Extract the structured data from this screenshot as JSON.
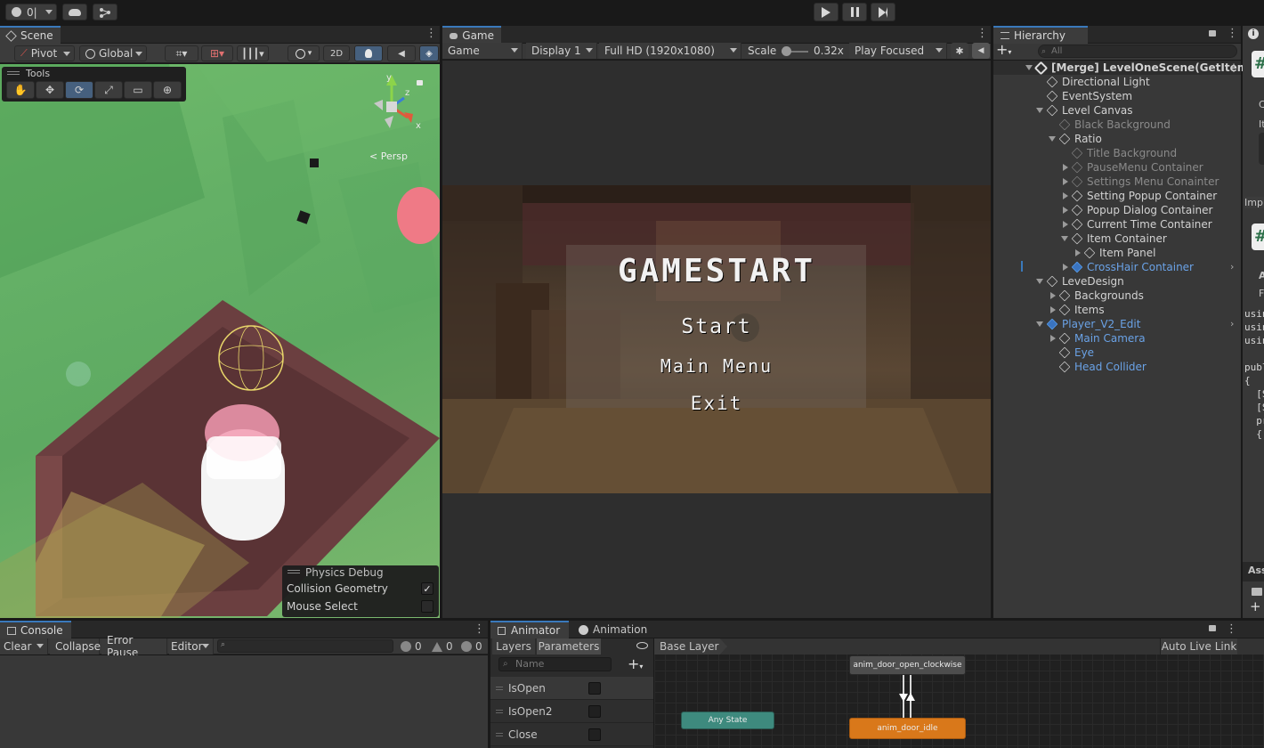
{
  "top": {
    "account_label": "0|"
  },
  "scene": {
    "tab": "Scene",
    "pivot": "Pivot",
    "global": "Global",
    "btn_2d": "2D",
    "tools_title": "Tools",
    "persp": "< Persp",
    "gizmo_y": "y",
    "gizmo_z": "z",
    "gizmo_x": "x",
    "physics_debug": {
      "title": "Physics Debug",
      "collision_geometry": "Collision Geometry",
      "collision_checked": true,
      "mouse_select": "Mouse Select",
      "mouse_checked": false
    }
  },
  "game": {
    "tab": "Game",
    "view": "Game",
    "display": "Display 1",
    "resolution": "Full HD (1920x1080)",
    "scale_label": "Scale",
    "scale_value": "0.32x",
    "play_mode": "Play Focused",
    "menu": {
      "title": "GAMESTART",
      "start": "Start",
      "main_menu": "Main Menu",
      "exit": "Exit"
    }
  },
  "hierarchy": {
    "tab": "Hierarchy",
    "search_placeholder": "All",
    "scene_name": "[Merge] LevelOneScene(GetItem",
    "items": [
      {
        "label": "Directional Light"
      },
      {
        "label": "EventSystem"
      },
      {
        "label": "Level Canvas"
      },
      {
        "label": "Black Background"
      },
      {
        "label": "Ratio"
      },
      {
        "label": "Title Background"
      },
      {
        "label": "PauseMenu Container"
      },
      {
        "label": "Settings Menu Conainter"
      },
      {
        "label": "Setting Popup Container"
      },
      {
        "label": "Popup Dialog Container"
      },
      {
        "label": "Current Time Container"
      },
      {
        "label": "Item Container"
      },
      {
        "label": "Item Panel"
      },
      {
        "label": "CrossHair Container"
      },
      {
        "label": "LeveDesign"
      },
      {
        "label": "Backgrounds"
      },
      {
        "label": "Items"
      },
      {
        "label": "Player_V2_Edit"
      },
      {
        "label": "Main Camera"
      },
      {
        "label": "Eye"
      },
      {
        "label": "Head Collider"
      }
    ]
  },
  "inspector": {
    "partial_labels": [
      "C",
      "It",
      "Imp",
      "A",
      "F",
      "Ass"
    ],
    "code_lines": [
      "usin",
      "usin",
      "usin",
      "",
      "publ",
      "{",
      "  [S",
      "  [S",
      "  pr",
      "  {"
    ],
    "hash1": "#",
    "hash2": "#"
  },
  "console": {
    "tab": "Console",
    "clear": "Clear",
    "collapse": "Collapse",
    "error_pause": "Error Pause",
    "editor": "Editor",
    "info_count": "0",
    "warn_count": "0",
    "error_count": "0"
  },
  "animator": {
    "tab": "Animator",
    "tab2": "Animation",
    "layers": "Layers",
    "parameters": "Parameters",
    "search_placeholder": "Name",
    "base_layer": "Base Layer",
    "auto_live_link": "Auto Live Link",
    "params": [
      {
        "name": "IsOpen"
      },
      {
        "name": "IsOpen2"
      },
      {
        "name": "Close"
      }
    ],
    "nodes": {
      "open_cw": "anim_door_open_clockwise",
      "any_state": "Any State",
      "idle": "anim_door_idle"
    }
  },
  "colors": {
    "accent": "#3a79bb",
    "node_orange": "#d9781a",
    "node_teal": "#3e8a7e"
  }
}
